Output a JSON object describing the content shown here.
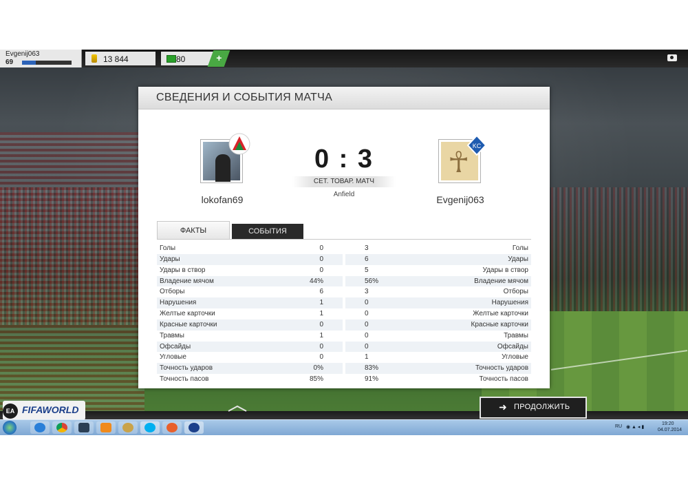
{
  "topbar": {
    "username": "Evgenij063",
    "level": "69",
    "xp_progress": 0.28,
    "coins": "13 844",
    "points": "80",
    "add_label": "+"
  },
  "panel": {
    "title": "СВЕДЕНИЯ И СОБЫТИЯ МАТЧА",
    "home_name": "lokofan69",
    "away_name": "Evgenij063",
    "score": "0 : 3",
    "match_type": "СЕТ. ТОВАР. МАТЧ",
    "stadium": "Anfield",
    "tabs": {
      "facts": "ФАКТЫ",
      "events": "СОБЫТИЯ"
    }
  },
  "stats": [
    {
      "label": "Голы",
      "home": "0",
      "away": "3"
    },
    {
      "label": "Удары",
      "home": "0",
      "away": "6"
    },
    {
      "label": "Удары в створ",
      "home": "0",
      "away": "5"
    },
    {
      "label": "Владение мячом",
      "home": "44%",
      "away": "56%"
    },
    {
      "label": "Отборы",
      "home": "6",
      "away": "3"
    },
    {
      "label": "Нарушения",
      "home": "1",
      "away": "0"
    },
    {
      "label": "Желтые карточки",
      "home": "1",
      "away": "0"
    },
    {
      "label": "Красные карточки",
      "home": "0",
      "away": "0"
    },
    {
      "label": "Травмы",
      "home": "1",
      "away": "0"
    },
    {
      "label": "Офсайды",
      "home": "0",
      "away": "0"
    },
    {
      "label": "Угловые",
      "home": "0",
      "away": "1"
    },
    {
      "label": "Точность ударов",
      "home": "0%",
      "away": "83%"
    },
    {
      "label": "Точность пасов",
      "home": "85%",
      "away": "91%"
    }
  ],
  "continue_label": "ПРОДОЛЖИТЬ",
  "brand": {
    "ea": "EA",
    "fifa": "FIFAWORLD"
  },
  "taskbar": {
    "lang": "RU",
    "time": "19:20",
    "date": "04.07.2014"
  },
  "colors": {
    "accent_blue": "#2c63b8",
    "green": "#49a843",
    "panel_bg": "#ffffff"
  }
}
